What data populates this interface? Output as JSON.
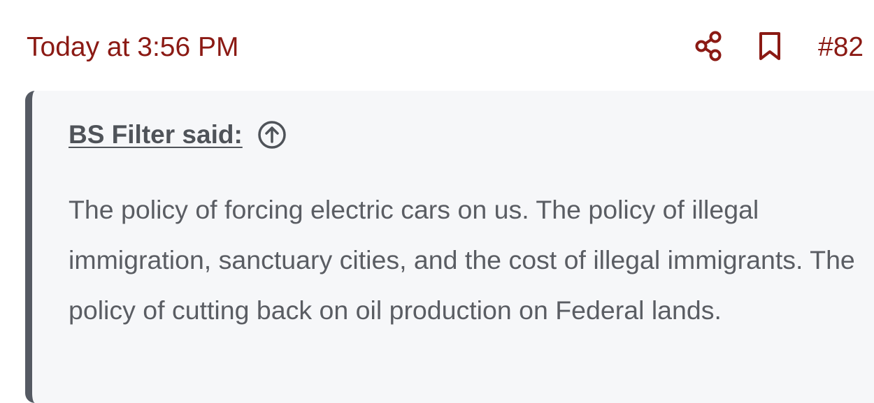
{
  "post": {
    "timestamp": "Today at 3:56 PM",
    "number": "#82",
    "accent_color": "#8b1a14"
  },
  "icons": {
    "share": "share-icon",
    "bookmark": "bookmark-icon",
    "jump_to_quote": "arrow-up-circle-icon"
  },
  "quote": {
    "author_label": "BS Filter said:",
    "text": "The policy of forcing electric cars on us. The policy of illegal immigration, sanctuary cities, and the cost of illegal immigrants. The policy of cutting back on oil production on Federal lands.",
    "border_color": "#555a63",
    "background_color": "#f6f7f9"
  }
}
